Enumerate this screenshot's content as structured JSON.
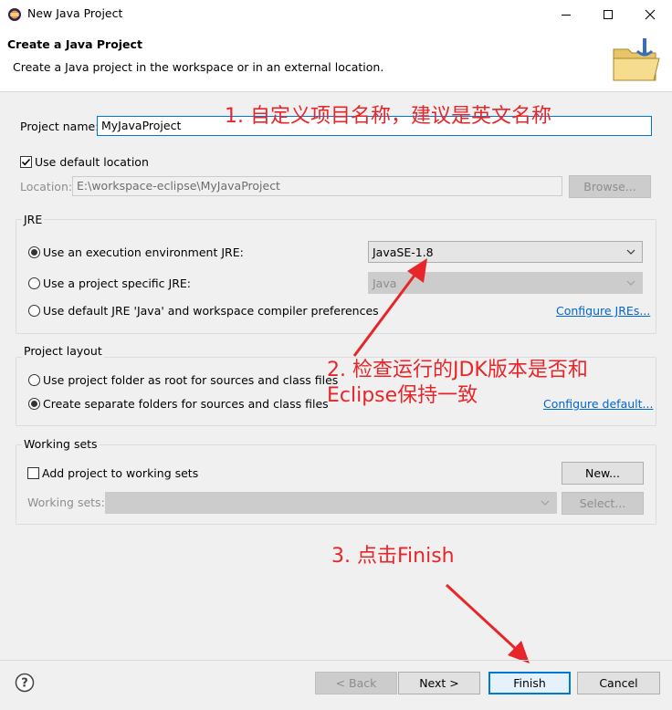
{
  "window": {
    "title": "New Java Project"
  },
  "banner": {
    "title": "Create a Java Project",
    "description": "Create a Java project in the workspace or in an external location."
  },
  "project": {
    "name_label": "Project name:",
    "name_value": "MyJavaProject",
    "use_default_location_label": "Use default location",
    "use_default_location_checked": true,
    "location_label": "Location:",
    "location_value": "E:\\workspace-eclipse\\MyJavaProject",
    "browse_label": "Browse..."
  },
  "jre": {
    "group_title": "JRE",
    "options": [
      {
        "label": "Use an execution environment JRE:",
        "selected": true
      },
      {
        "label": "Use a project specific JRE:",
        "selected": false
      },
      {
        "label": "Use default JRE 'Java' and workspace compiler preferences",
        "selected": false
      }
    ],
    "execution_env_value": "JavaSE-1.8",
    "project_specific_value": "Java",
    "configure_link": "Configure JREs..."
  },
  "layout": {
    "group_title": "Project layout",
    "options": [
      {
        "label": "Use project folder as root for sources and class files",
        "selected": false
      },
      {
        "label": "Create separate folders for sources and class files",
        "selected": true
      }
    ],
    "configure_link": "Configure default..."
  },
  "working_sets": {
    "group_title": "Working sets",
    "add_label": "Add project to working sets",
    "add_checked": false,
    "new_label": "New...",
    "sets_label": "Working sets:",
    "select_label": "Select..."
  },
  "footer": {
    "back_label": "< Back",
    "next_label": "Next >",
    "finish_label": "Finish",
    "cancel_label": "Cancel"
  },
  "annotations": {
    "note1": "1. 自定义项目名称，建议是英文名称",
    "note2_line1": "2. 检查运行的JDK版本是否和",
    "note2_line2": "Eclipse保持一致",
    "note3": "3. 点击Finish",
    "color": "#e8262a"
  }
}
